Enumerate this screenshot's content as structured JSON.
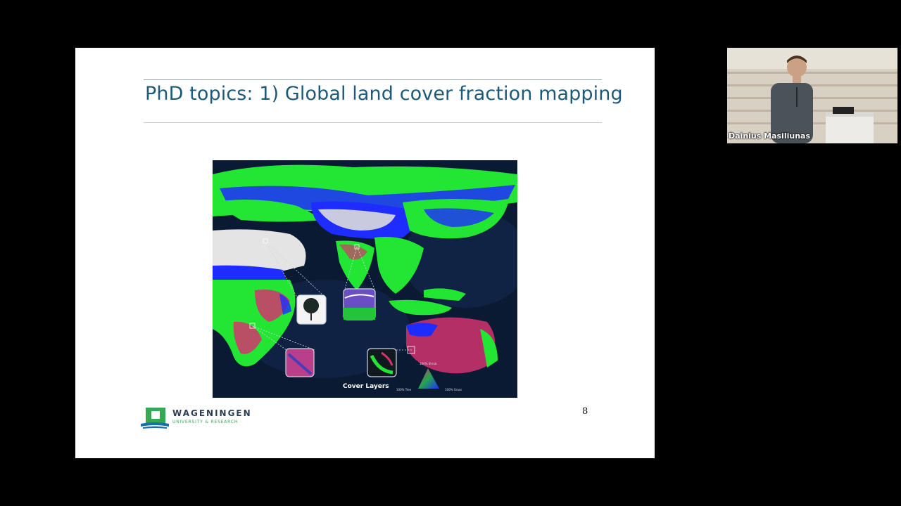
{
  "slide": {
    "title": "PhD topics: 1) Global land cover fraction mapping",
    "page_number": "8",
    "map": {
      "caption": "Cover Layers",
      "triangle_labels": {
        "top": "100% Shrub",
        "left": "100% Tree",
        "right": "100% Grass"
      },
      "colors": {
        "ocean": "#0b1a33",
        "tree": "#22e633",
        "grass": "#1f2cff",
        "shrub": "#d2346e",
        "bare": "#e4e4e4"
      }
    },
    "logo": {
      "name": "WAGENINGEN",
      "subtitle": "UNIVERSITY & RESEARCH",
      "colors": {
        "green": "#34a853",
        "blue": "#1b6fa8"
      }
    }
  },
  "webcam": {
    "speaker_name": "Dainius Masiliunas"
  }
}
